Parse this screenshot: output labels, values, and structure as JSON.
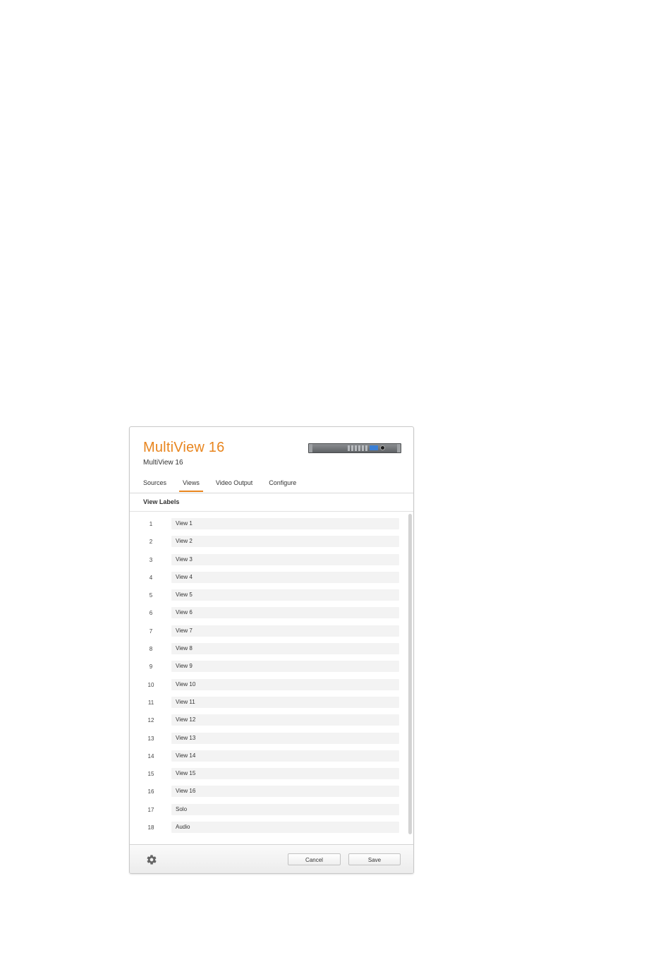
{
  "header": {
    "title": "MultiView 16",
    "subtitle": "MultiView 16"
  },
  "tabs": [
    {
      "label": "Sources",
      "active": false
    },
    {
      "label": "Views",
      "active": true
    },
    {
      "label": "Video Output",
      "active": false
    },
    {
      "label": "Configure",
      "active": false
    }
  ],
  "section": {
    "title": "View Labels"
  },
  "view_labels": [
    {
      "number": "1",
      "value": "View 1"
    },
    {
      "number": "2",
      "value": "View 2"
    },
    {
      "number": "3",
      "value": "View 3"
    },
    {
      "number": "4",
      "value": "View 4"
    },
    {
      "number": "5",
      "value": "View 5"
    },
    {
      "number": "6",
      "value": "View 6"
    },
    {
      "number": "7",
      "value": "View 7"
    },
    {
      "number": "8",
      "value": "View 8"
    },
    {
      "number": "9",
      "value": "View 9"
    },
    {
      "number": "10",
      "value": "View 10"
    },
    {
      "number": "11",
      "value": "View 11"
    },
    {
      "number": "12",
      "value": "View 12"
    },
    {
      "number": "13",
      "value": "View 13"
    },
    {
      "number": "14",
      "value": "View 14"
    },
    {
      "number": "15",
      "value": "View 15"
    },
    {
      "number": "16",
      "value": "View 16"
    },
    {
      "number": "17",
      "value": "Solo"
    },
    {
      "number": "18",
      "value": "Audio"
    }
  ],
  "footer": {
    "settings_icon": "gear-icon",
    "cancel_label": "Cancel",
    "save_label": "Save"
  },
  "colors": {
    "accent": "#e8851e",
    "field_background": "#f3f3f3"
  }
}
